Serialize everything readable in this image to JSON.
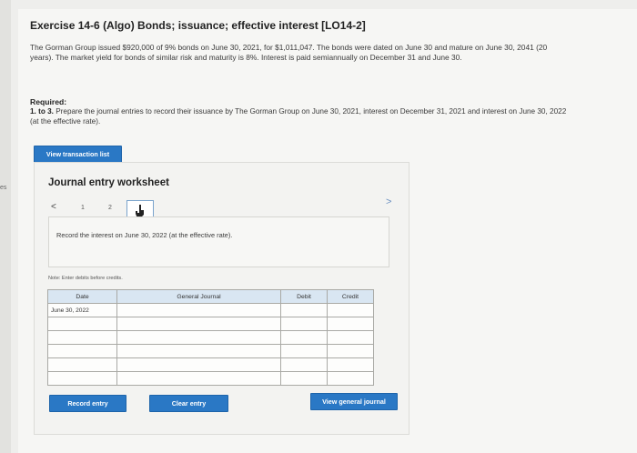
{
  "left_edge": {
    "label": "es"
  },
  "exercise": {
    "title": "Exercise 14-6 (Algo) Bonds; issuance; effective interest [LO14-2]",
    "intro": "The Gorman Group issued $920,000 of 9% bonds on June 30, 2021, for $1,011,047. The bonds were dated on June 30 and mature on June 30, 2041 (20 years). The market yield for bonds of similar risk and maturity is 8%. Interest is paid semiannually on December 31 and June 30.",
    "required_label": "Required:",
    "required_prefix": "1. to 3.",
    "required_text": " Prepare the journal entries to record their issuance by The Gorman Group on June 30, 2021, interest on December 31, 2021 and interest on June 30, 2022 (at the effective rate)."
  },
  "buttons": {
    "view_transaction_list": "View transaction list",
    "record_entry": "Record entry",
    "clear_entry": "Clear entry",
    "view_general_journal": "View general journal"
  },
  "worksheet": {
    "title": "Journal entry worksheet",
    "nav": {
      "prev": "<",
      "pages": [
        "1",
        "2"
      ],
      "next": ">"
    },
    "instruction": "Record the interest on June 30, 2022 (at the effective rate).",
    "note": "Note: Enter debits before credits.",
    "table": {
      "headers": [
        "Date",
        "General Journal",
        "Debit",
        "Credit"
      ],
      "rows": [
        [
          "June 30, 2022",
          "",
          "",
          ""
        ],
        [
          "",
          "",
          "",
          ""
        ],
        [
          "",
          "",
          "",
          ""
        ],
        [
          "",
          "",
          "",
          ""
        ],
        [
          "",
          "",
          "",
          ""
        ],
        [
          "",
          "",
          "",
          ""
        ]
      ]
    }
  },
  "colors": {
    "button": "#2a78c5",
    "table_header": "#d9e6f2"
  },
  "icons": {
    "current_page": "hand-pointer-icon"
  }
}
